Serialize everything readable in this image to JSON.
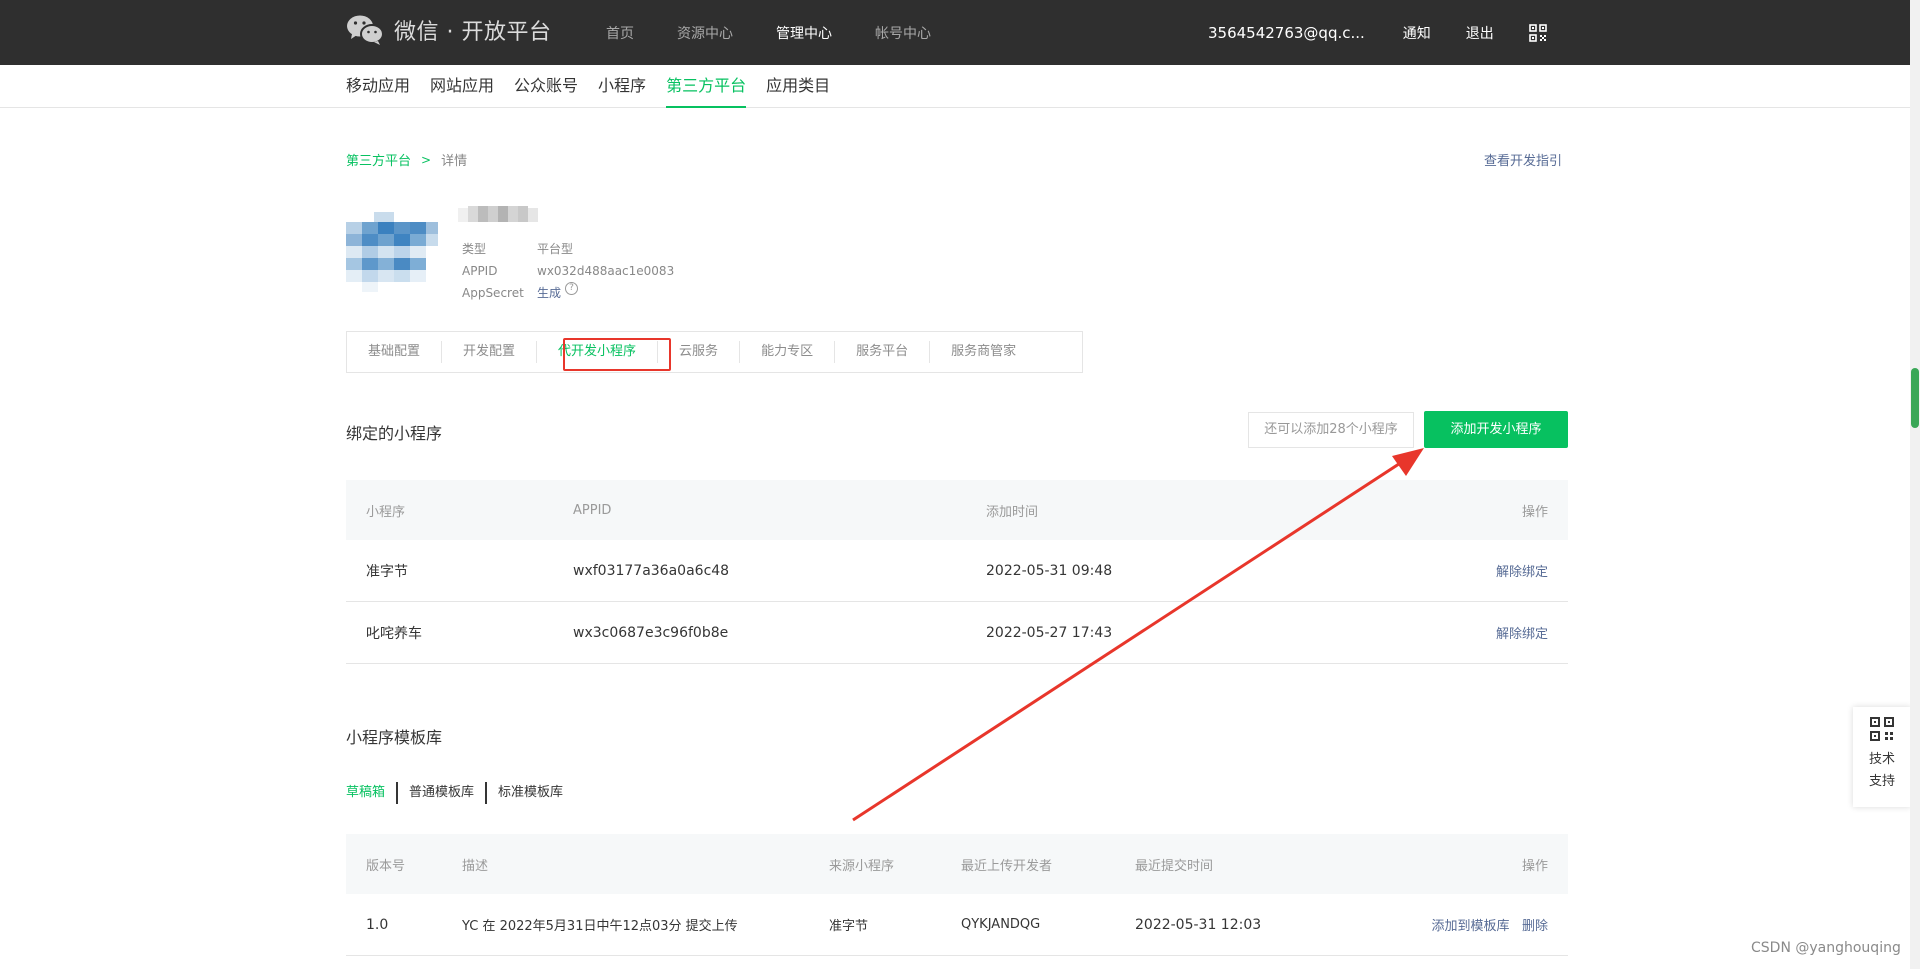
{
  "header": {
    "logo_text": "微信 · 开放平台",
    "nav": [
      "首页",
      "资源中心",
      "管理中心",
      "帐号中心"
    ],
    "nav_active": "管理中心",
    "account": "3564542763@qq.c...",
    "notify": "通知",
    "logout": "退出",
    "icon": "qrcode-icon"
  },
  "subnav": {
    "items": [
      "移动应用",
      "网站应用",
      "公众账号",
      "小程序",
      "第三方平台",
      "应用类目"
    ],
    "active": "第三方平台"
  },
  "breadcrumb": {
    "parent": "第三方平台",
    "separator": ">",
    "current": "详情"
  },
  "dev_guide": "查看开发指引",
  "app_info": {
    "type_label": "类型",
    "type_value": "平台型",
    "appid_label": "APPID",
    "appid_value": "wx032d488aac1e0083",
    "secret_label": "AppSecret",
    "secret_action": "生成",
    "help": "?"
  },
  "tabs": {
    "items": [
      "基础配置",
      "开发配置",
      "代开发小程序",
      "云服务",
      "能力专区",
      "服务平台",
      "服务商管家"
    ],
    "active": "代开发小程序"
  },
  "bound": {
    "title": "绑定的小程序",
    "quota": "还可以添加28个小程序",
    "add_button": "添加开发小程序",
    "columns": [
      "小程序",
      "APPID",
      "添加时间",
      "操作"
    ],
    "rows": [
      {
        "name": "准字节",
        "appid": "wxf03177a36a0a6c48",
        "time": "2022-05-31 09:48",
        "action": "解除绑定"
      },
      {
        "name": "叱咤养车",
        "appid": "wx3c0687e3c96f0b8e",
        "time": "2022-05-27 17:43",
        "action": "解除绑定"
      }
    ]
  },
  "templates": {
    "title": "小程序模板库",
    "tabs": [
      "草稿箱",
      "普通模板库",
      "标准模板库"
    ],
    "active_tab": "草稿箱",
    "columns": [
      "版本号",
      "描述",
      "来源小程序",
      "最近上传开发者",
      "最近提交时间",
      "操作"
    ],
    "rows": [
      {
        "version": "1.0",
        "desc": "YC 在 2022年5月31日中午12点03分 提交上传",
        "source": "准字节",
        "developer": "QYKJANDQG",
        "time": "2022-05-31 12:03",
        "action_add": "添加到模板库",
        "action_delete": "删除"
      }
    ]
  },
  "support": {
    "line1": "技术",
    "line2": "支持",
    "icon": "qrcode-icon"
  },
  "watermark": "CSDN @yanghouqing",
  "colors": {
    "brand_green": "#07c160",
    "link_blue": "#576b95",
    "header_bg": "#2f2f2f",
    "annotation_red": "#e8362b"
  }
}
